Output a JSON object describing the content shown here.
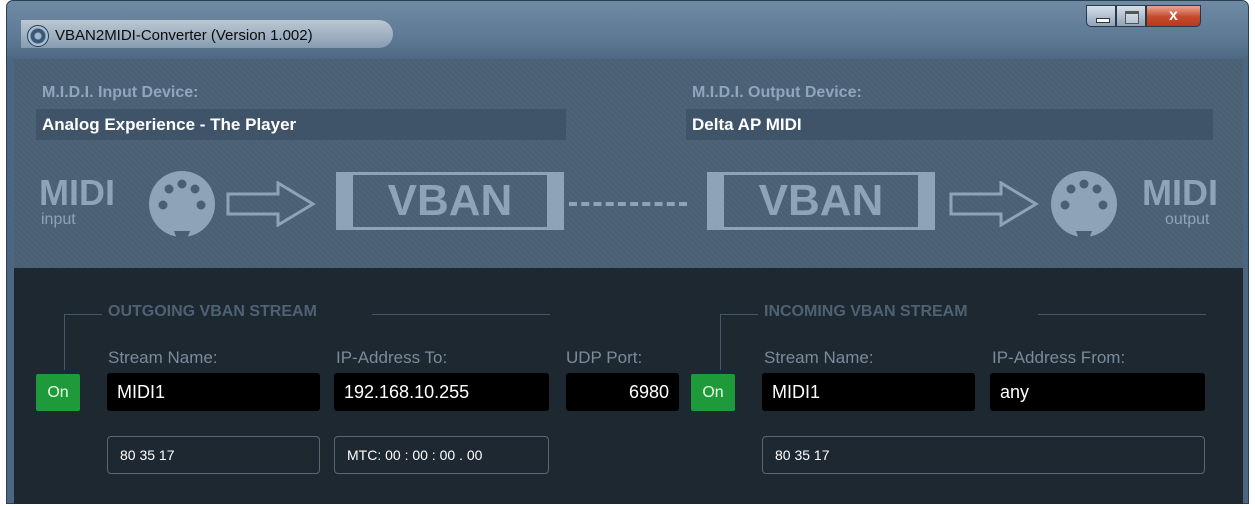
{
  "window": {
    "title": "VBAN2MIDI-Converter (Version 1.002)",
    "controls": {
      "minimize_icon": "minimize-icon",
      "maximize_icon": "maximize-icon",
      "close_label": "x"
    }
  },
  "midi_in": {
    "label": "M.I.D.I. Input Device:",
    "device": "Analog Experience - The Player",
    "big": "MIDI",
    "small": "input"
  },
  "midi_out": {
    "label": "M.I.D.I. Output Device:",
    "device": "Delta AP MIDI",
    "big": "MIDI",
    "small": "output"
  },
  "diagram": {
    "vban_left": "VBAN",
    "vban_right": "VBAN"
  },
  "outgoing": {
    "title": "OUTGOING VBAN STREAM",
    "on_label": "On",
    "stream_name_label": "Stream Name:",
    "stream_name": "MIDI1",
    "ip_label": "IP-Address To:",
    "ip": "192.168.10.255",
    "port_label": "UDP Port:",
    "port": "6980",
    "monitor": "80 35 17",
    "mtc": "MTC: 00 : 00 : 00 . 00"
  },
  "incoming": {
    "title": "INCOMING VBAN STREAM",
    "on_label": "On",
    "stream_name_label": "Stream Name:",
    "stream_name": "MIDI1",
    "ip_label": "IP-Address From:",
    "ip": "any",
    "monitor": "80 35 17"
  },
  "colors": {
    "on_green": "#1f9a3a",
    "panel_dark": "#1e2831",
    "accent_steel": "#8ea3b8"
  }
}
